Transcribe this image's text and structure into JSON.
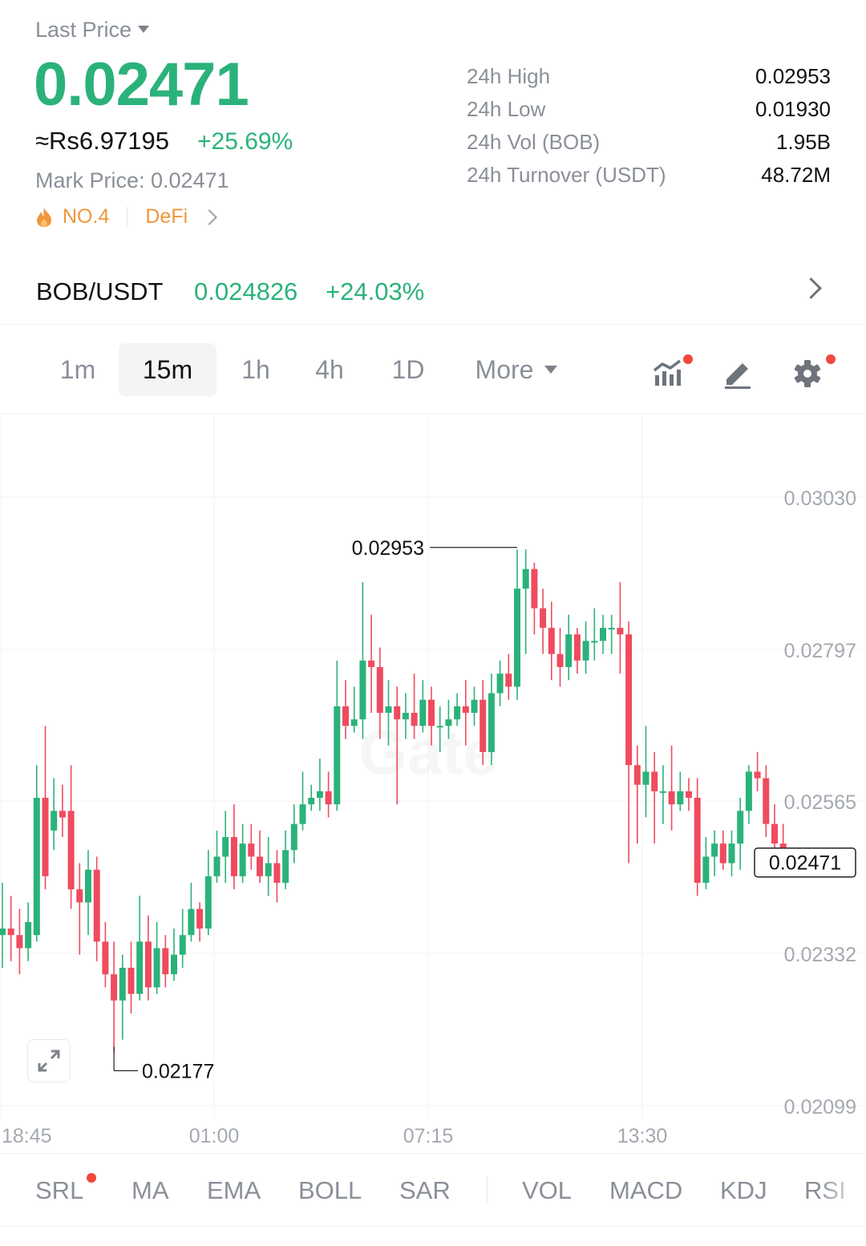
{
  "header": {
    "last_price_label": "Last Price",
    "last_price": "0.02471",
    "fiat_price": "≈Rs6.97195",
    "change_pct": "+25.69%",
    "mark_price": "Mark Price:  0.02471",
    "rank": "NO.4",
    "category": "DeFi"
  },
  "stats": [
    {
      "label": "24h High",
      "value": "0.02953"
    },
    {
      "label": "24h Low",
      "value": "0.01930"
    },
    {
      "label": "24h Vol (BOB)",
      "value": "1.95B"
    },
    {
      "label": "24h Turnover (USDT)",
      "value": "48.72M"
    }
  ],
  "pair": {
    "name": "BOB/USDT",
    "price": "0.024826",
    "change": "+24.03%"
  },
  "intervals": {
    "active": "15m",
    "items": [
      "1m",
      "15m",
      "1h",
      "4h",
      "1D",
      "More"
    ]
  },
  "tools": [
    "indicator-chart-icon",
    "draw-pen-icon",
    "settings-gear-icon"
  ],
  "colors": {
    "up": "#2bb27a",
    "down": "#ef4b5f",
    "accent_orange": "#f0963c",
    "notification_dot": "#f0483e"
  },
  "chart_data": {
    "type": "candlestick",
    "watermark": "Gate",
    "y_ticks": [
      "0.03030",
      "0.02797",
      "0.02565",
      "0.02332",
      "0.02099"
    ],
    "x_ticks": [
      "18:45",
      "01:00",
      "07:15",
      "13:30"
    ],
    "ylim": [
      0.02099,
      0.0303
    ],
    "high_label": "0.02953",
    "low_label": "0.02177",
    "current_price_label": "0.02471",
    "current_price": 0.02471,
    "candles": [
      [
        0.0236,
        0.0237,
        0.0244,
        0.0231
      ],
      [
        0.0237,
        0.0236,
        0.0242,
        0.0232
      ],
      [
        0.0236,
        0.0234,
        0.024,
        0.023
      ],
      [
        0.0234,
        0.0238,
        0.0241,
        0.0232
      ],
      [
        0.0236,
        0.0257,
        0.0262,
        0.0235
      ],
      [
        0.0257,
        0.0245,
        0.0268,
        0.0243
      ],
      [
        0.0252,
        0.0255,
        0.026,
        0.0249
      ],
      [
        0.0255,
        0.0254,
        0.0259,
        0.0251
      ],
      [
        0.0255,
        0.0243,
        0.0262,
        0.024
      ],
      [
        0.0243,
        0.0241,
        0.0247,
        0.0233
      ],
      [
        0.0241,
        0.0246,
        0.0249,
        0.0236
      ],
      [
        0.0246,
        0.0235,
        0.0248,
        0.0232
      ],
      [
        0.0235,
        0.023,
        0.0238,
        0.0228
      ],
      [
        0.023,
        0.0226,
        0.0235,
        0.0218
      ],
      [
        0.0226,
        0.0231,
        0.0233,
        0.022
      ],
      [
        0.0231,
        0.0227,
        0.0235,
        0.0224
      ],
      [
        0.0227,
        0.0235,
        0.0242,
        0.0226
      ],
      [
        0.0235,
        0.0228,
        0.0239,
        0.0226
      ],
      [
        0.0228,
        0.0234,
        0.0238,
        0.0227
      ],
      [
        0.0234,
        0.023,
        0.0236,
        0.0228
      ],
      [
        0.023,
        0.0233,
        0.0237,
        0.0229
      ],
      [
        0.0233,
        0.0236,
        0.024,
        0.0231
      ],
      [
        0.0236,
        0.024,
        0.0244,
        0.0235
      ],
      [
        0.024,
        0.0237,
        0.0241,
        0.0235
      ],
      [
        0.0237,
        0.0245,
        0.0249,
        0.0236
      ],
      [
        0.0245,
        0.0248,
        0.0252,
        0.0244
      ],
      [
        0.0248,
        0.0251,
        0.0255,
        0.0244
      ],
      [
        0.0251,
        0.0245,
        0.0256,
        0.0243
      ],
      [
        0.0245,
        0.025,
        0.0253,
        0.0244
      ],
      [
        0.025,
        0.0248,
        0.0253,
        0.0246
      ],
      [
        0.0248,
        0.0245,
        0.0252,
        0.0244
      ],
      [
        0.0245,
        0.0247,
        0.0251,
        0.0242
      ],
      [
        0.0247,
        0.0244,
        0.0249,
        0.0241
      ],
      [
        0.0244,
        0.0249,
        0.0252,
        0.0243
      ],
      [
        0.0249,
        0.0253,
        0.0256,
        0.0247
      ],
      [
        0.0253,
        0.0256,
        0.0261,
        0.0252
      ],
      [
        0.0256,
        0.0257,
        0.0259,
        0.0255
      ],
      [
        0.0257,
        0.0258,
        0.0263,
        0.0255
      ],
      [
        0.0258,
        0.0256,
        0.0261,
        0.0254
      ],
      [
        0.0256,
        0.0271,
        0.0278,
        0.0255
      ],
      [
        0.0271,
        0.0268,
        0.0275,
        0.0266
      ],
      [
        0.0268,
        0.0269,
        0.0274,
        0.0267
      ],
      [
        0.0269,
        0.0278,
        0.029,
        0.0266
      ],
      [
        0.0278,
        0.0277,
        0.0285,
        0.027
      ],
      [
        0.0277,
        0.027,
        0.028,
        0.0266
      ],
      [
        0.027,
        0.0271,
        0.0275,
        0.0265
      ],
      [
        0.0271,
        0.0269,
        0.0274,
        0.0256
      ],
      [
        0.0269,
        0.027,
        0.0273,
        0.0266
      ],
      [
        0.027,
        0.0268,
        0.0276,
        0.0266
      ],
      [
        0.0268,
        0.0272,
        0.0275,
        0.0267
      ],
      [
        0.0272,
        0.0268,
        0.0274,
        0.0265
      ],
      [
        0.0268,
        0.0268,
        0.0271,
        0.0264
      ],
      [
        0.0268,
        0.0269,
        0.0272,
        0.0266
      ],
      [
        0.0269,
        0.0271,
        0.0273,
        0.0268
      ],
      [
        0.0271,
        0.027,
        0.0275,
        0.0265
      ],
      [
        0.027,
        0.0272,
        0.0274,
        0.0268
      ],
      [
        0.0272,
        0.0264,
        0.0275,
        0.0262
      ],
      [
        0.0264,
        0.0273,
        0.0276,
        0.0262
      ],
      [
        0.0273,
        0.0276,
        0.0278,
        0.0271
      ],
      [
        0.0276,
        0.0274,
        0.0279,
        0.0272
      ],
      [
        0.0274,
        0.0289,
        0.0295,
        0.0272
      ],
      [
        0.0289,
        0.0292,
        0.0295,
        0.0279
      ],
      [
        0.0292,
        0.0286,
        0.0293,
        0.0282
      ],
      [
        0.0286,
        0.0283,
        0.0289,
        0.0279
      ],
      [
        0.0283,
        0.0279,
        0.0287,
        0.0275
      ],
      [
        0.0279,
        0.0277,
        0.0283,
        0.0274
      ],
      [
        0.0277,
        0.0282,
        0.0285,
        0.0275
      ],
      [
        0.0282,
        0.0278,
        0.0283,
        0.0276
      ],
      [
        0.0278,
        0.0281,
        0.0284,
        0.0276
      ],
      [
        0.0281,
        0.0281,
        0.0286,
        0.0278
      ],
      [
        0.0281,
        0.0283,
        0.0285,
        0.0279
      ],
      [
        0.0283,
        0.0283,
        0.0285,
        0.0279
      ],
      [
        0.0283,
        0.0282,
        0.029,
        0.0276
      ],
      [
        0.0282,
        0.0262,
        0.0284,
        0.0247
      ],
      [
        0.0262,
        0.0259,
        0.0265,
        0.025
      ],
      [
        0.0259,
        0.0261,
        0.0268,
        0.0254
      ],
      [
        0.0261,
        0.0258,
        0.0264,
        0.025
      ],
      [
        0.0258,
        0.0258,
        0.0262,
        0.0253
      ],
      [
        0.0258,
        0.0256,
        0.0265,
        0.0252
      ],
      [
        0.0256,
        0.0258,
        0.0261,
        0.0255
      ],
      [
        0.0258,
        0.0257,
        0.026,
        0.0255
      ],
      [
        0.0257,
        0.0244,
        0.026,
        0.0242
      ],
      [
        0.0244,
        0.0248,
        0.0251,
        0.0243
      ],
      [
        0.0248,
        0.025,
        0.0252,
        0.0245
      ],
      [
        0.025,
        0.0247,
        0.0252,
        0.0246
      ],
      [
        0.0247,
        0.025,
        0.0252,
        0.0245
      ],
      [
        0.025,
        0.0255,
        0.0257,
        0.0246
      ],
      [
        0.0255,
        0.0261,
        0.0262,
        0.0253
      ],
      [
        0.0261,
        0.026,
        0.0264,
        0.0258
      ],
      [
        0.026,
        0.0253,
        0.0262,
        0.0251
      ],
      [
        0.0253,
        0.025,
        0.0256,
        0.0249
      ],
      [
        0.025,
        0.0247,
        0.0253,
        0.0246
      ],
      [
        0.0247,
        0.0247,
        0.0248,
        0.0246
      ]
    ]
  },
  "indicators": {
    "main": [
      "SRL",
      "MA",
      "EMA",
      "BOLL",
      "SAR"
    ],
    "sub": [
      "VOL",
      "MACD",
      "KDJ",
      "RSI"
    ]
  }
}
